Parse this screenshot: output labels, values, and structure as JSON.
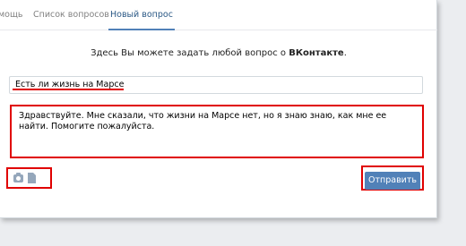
{
  "tabs": [
    {
      "label": "мощь"
    },
    {
      "label": "Список вопросов"
    },
    {
      "label": "Новый вопрос"
    }
  ],
  "intro": {
    "prefix": "Здесь Вы можете задать любой вопрос о ",
    "brand": "ВКонтакте",
    "suffix": "."
  },
  "question": {
    "title_value": "Есть ли жизнь на Марсе",
    "body_value": "Здравствуйте. Мне сказали, что жизни на Марсе нет, но я знаю знаю, как мне ее найти. Помогите пожалуйста."
  },
  "attachments": {
    "photo_icon": "camera-icon",
    "document_icon": "document-icon"
  },
  "actions": {
    "send_label": "Отправить"
  },
  "colors": {
    "accent": "#5181b8",
    "active_tab_text": "#2a5885",
    "annotation": "#e00000"
  }
}
